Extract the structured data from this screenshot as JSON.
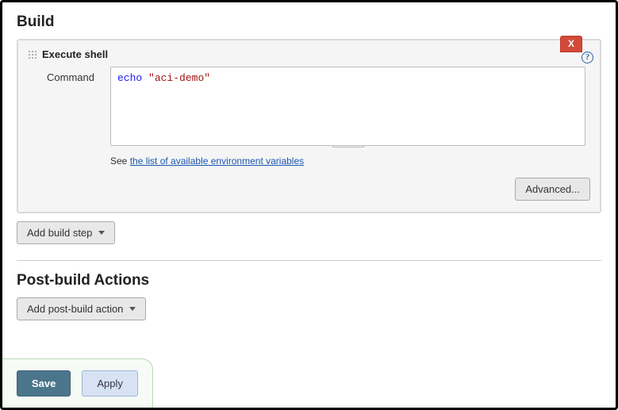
{
  "build": {
    "section_title": "Build",
    "step": {
      "close_label": "X",
      "title": "Execute shell",
      "command_label": "Command",
      "command_kw": "echo",
      "command_str": "\"aci-demo\"",
      "help_prefix": "See ",
      "help_link": "the list of available environment variables",
      "advanced_label": "Advanced..."
    },
    "add_step_label": "Add build step"
  },
  "post_build": {
    "section_title": "Post-build Actions",
    "add_action_label": "Add post-build action"
  },
  "footer": {
    "save": "Save",
    "apply": "Apply"
  }
}
